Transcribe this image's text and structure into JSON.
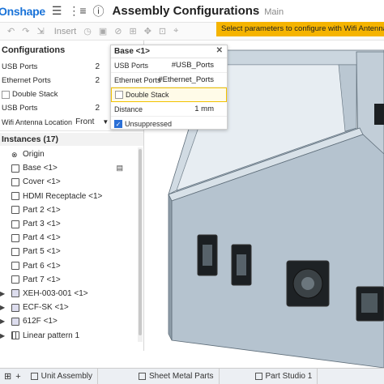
{
  "header": {
    "logo": "Onshape",
    "title": "Assembly Configurations",
    "branch": "Main"
  },
  "toolbar": {
    "insert_label": "Insert"
  },
  "banner": "Select parameters to configure with Wifi Antenna Location",
  "configurations": {
    "title": "Configurations",
    "rows": [
      {
        "label": "USB Ports",
        "value": "2"
      },
      {
        "label": "Ethernet Ports",
        "value": "2"
      }
    ],
    "double_stack_label": "Double Stack",
    "usb_ports_label": "USB Ports",
    "usb_ports_value": "2",
    "wifi_label": "Wifi Antenna Location",
    "wifi_value": "Front"
  },
  "dialog": {
    "title": "Base <1>",
    "usb_label": "USB Ports",
    "usb_value": "#USB_Ports",
    "eth_label": "Ethernet Ports",
    "eth_value": "#Ethernet_Ports",
    "double_stack_label": "Double Stack",
    "distance_label": "Distance",
    "distance_value": "1 mm",
    "unsuppressed_label": "Unsuppressed"
  },
  "instances": {
    "title": "Instances (17)",
    "items": [
      {
        "label": "Origin",
        "icon": "origin-icon"
      },
      {
        "label": "Base <1>",
        "icon": "part-icon"
      },
      {
        "label": "Cover <1>",
        "icon": "part-icon"
      },
      {
        "label": "HDMI Receptacle <1>",
        "icon": "part-icon"
      },
      {
        "label": "Part 2 <1>",
        "icon": "part-icon"
      },
      {
        "label": "Part 3 <1>",
        "icon": "part-icon"
      },
      {
        "label": "Part 4 <1>",
        "icon": "part-icon"
      },
      {
        "label": "Part 5 <1>",
        "icon": "part-icon"
      },
      {
        "label": "Part 6 <1>",
        "icon": "part-icon"
      },
      {
        "label": "Part 7 <1>",
        "icon": "part-icon"
      },
      {
        "label": "XEH-003-001 <1>",
        "icon": "assembly-icon"
      },
      {
        "label": "ECF-SK <1>",
        "icon": "assembly-icon"
      },
      {
        "label": "612F <1>",
        "icon": "assembly-icon"
      },
      {
        "label": "Linear pattern 1",
        "icon": "pattern-icon"
      }
    ]
  },
  "tabs": [
    {
      "label": "Unit Assembly"
    },
    {
      "label": "Sheet Metal Parts"
    },
    {
      "label": "Part Studio 1"
    }
  ],
  "colors": {
    "brand": "#1a73d8",
    "banner": "#f5b400",
    "part_steel": "#b9c7d3"
  }
}
